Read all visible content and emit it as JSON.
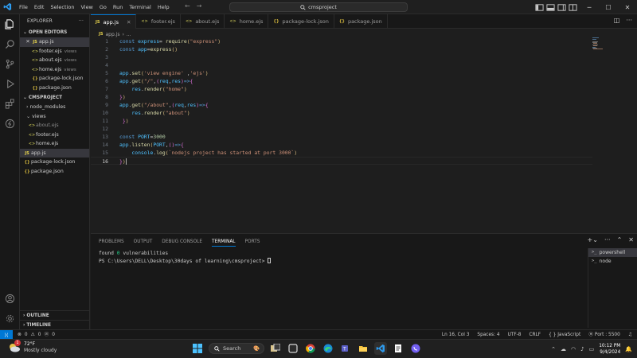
{
  "titlebar": {
    "menu": [
      "File",
      "Edit",
      "Selection",
      "View",
      "Go",
      "Run",
      "Terminal",
      "Help"
    ],
    "search_text": "cmsproject"
  },
  "sidebar": {
    "title": "EXPLORER",
    "open_editors_label": "OPEN EDITORS",
    "open_editors": [
      {
        "icon": "JS",
        "name": "app.js",
        "hint": "",
        "active": true
      },
      {
        "icon": "<>",
        "name": "footer.ejs",
        "hint": "views"
      },
      {
        "icon": "<>",
        "name": "about.ejs",
        "hint": "views"
      },
      {
        "icon": "<>",
        "name": "home.ejs",
        "hint": "views"
      },
      {
        "icon": "{}",
        "name": "package-lock.json",
        "hint": ""
      },
      {
        "icon": "{}",
        "name": "package.json",
        "hint": ""
      }
    ],
    "project_label": "CMSPROJECT",
    "tree": [
      {
        "name": "node_modules",
        "type": "folder"
      },
      {
        "name": "views",
        "type": "folder"
      },
      {
        "name": "about.ejs",
        "type": "ejs"
      },
      {
        "name": "footer.ejs",
        "type": "ejs"
      },
      {
        "name": "home.ejs",
        "type": "ejs"
      },
      {
        "name": "app.js",
        "type": "js"
      },
      {
        "name": "package-lock.json",
        "type": "json"
      },
      {
        "name": "package.json",
        "type": "json"
      }
    ],
    "outline_label": "OUTLINE",
    "timeline_label": "TIMELINE"
  },
  "tabs": [
    {
      "icon": "JS",
      "label": "app.js",
      "active": true
    },
    {
      "icon": "<>",
      "label": "footer.ejs"
    },
    {
      "icon": "<>",
      "label": "about.ejs"
    },
    {
      "icon": "<>",
      "label": "home.ejs"
    },
    {
      "icon": "{}",
      "label": "package-lock.json"
    },
    {
      "icon": "{}",
      "label": "package.json"
    }
  ],
  "breadcrumb": {
    "file": "app.js",
    "rest": "..."
  },
  "editor": {
    "current_line": 16,
    "line_numbers": [
      "1",
      "2",
      "3",
      "4",
      "5",
      "6",
      "7",
      "8",
      "9",
      "10",
      "11",
      "12",
      "13",
      "14",
      "15",
      "16"
    ],
    "lines": [
      "const express= require(\"express\")",
      "const app=express()",
      "",
      "",
      "app.set('view engine' ,'ejs')",
      "app.get(\"/\",(req,res)=>{",
      "    res.render(\"home\")",
      "})",
      "app.get(\"/about\",(req,res)=>{",
      "    res.render(\"about\")",
      " })",
      "",
      "const PORT=3000",
      "app.listen(PORT,()=>{",
      "    console.log(`nodejs project has started at port 3000`)",
      "})"
    ]
  },
  "panel": {
    "tabs": [
      "PROBLEMS",
      "OUTPUT",
      "DEBUG CONSOLE",
      "TERMINAL",
      "PORTS"
    ],
    "active_tab": "TERMINAL",
    "terminal_line1_prefix": "found ",
    "terminal_line1_count": "0",
    "terminal_line1_suffix": " vulnerabilities",
    "terminal_prompt": "PS C:\\Users\\DELL\\Desktop\\30days of learning\\cmsproject> ",
    "terminals": [
      "powershell",
      "node"
    ]
  },
  "statusbar": {
    "errors": "0",
    "warnings": "0",
    "info": "0",
    "position": "Ln 16, Col 3",
    "spaces": "Spaces: 4",
    "encoding": "UTF-8",
    "eol": "CRLF",
    "language": "JavaScript",
    "port": "Port : 5500"
  },
  "taskbar": {
    "weather_temp": "72°F",
    "weather_cond": "Mostly cloudy",
    "weather_badge": "1",
    "search_label": "Search",
    "time": "10:12 PM",
    "date": "9/4/2024"
  },
  "colors": {
    "accent": "#0078d4",
    "keyword": "#569cd6",
    "variable": "#4fc1ff",
    "function": "#dcdcaa",
    "string": "#ce9178"
  }
}
